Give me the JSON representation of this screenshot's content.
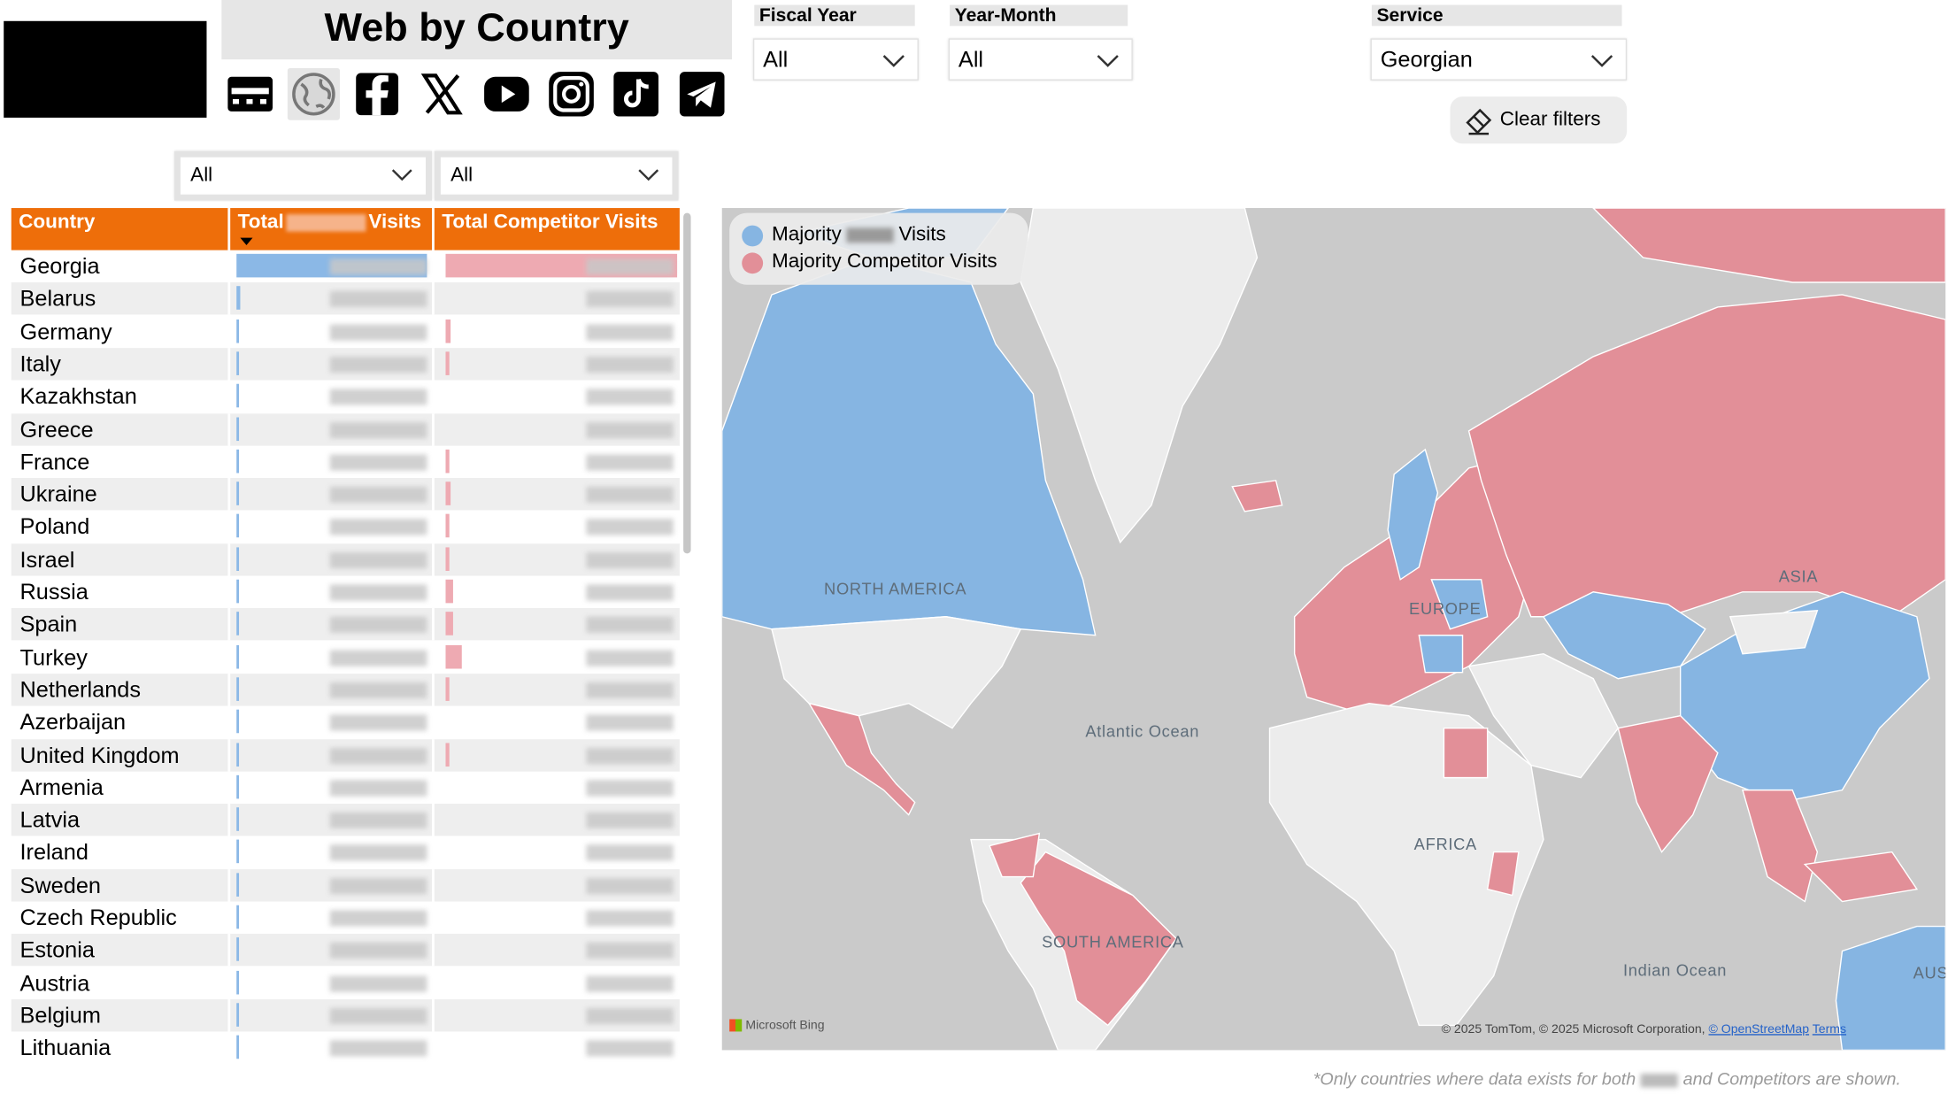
{
  "header": {
    "title": "Web by Country",
    "nav_icons": [
      "web-icon",
      "globe-icon",
      "facebook-icon",
      "x-icon",
      "youtube-icon",
      "instagram-icon",
      "tiktok-icon",
      "telegram-icon"
    ]
  },
  "filters": {
    "fiscal_year": {
      "label": "Fiscal Year",
      "value": "All"
    },
    "year_month": {
      "label": "Year-Month",
      "value": "All"
    },
    "service": {
      "label": "Service",
      "value": "Georgian"
    },
    "clear_label": "Clear filters",
    "column_filter_1": "All",
    "column_filter_2": "All"
  },
  "table": {
    "headers": {
      "country": "Country",
      "total_visits_prefix": "Total",
      "total_visits_suffix": "Visits",
      "competitor": "Total Competitor Visits"
    },
    "rows": [
      {
        "country": "Georgia",
        "visits_share": 1.0,
        "competitor_share": 1.0
      },
      {
        "country": "Belarus",
        "visits_share": 0.02,
        "competitor_share": 0.0
      },
      {
        "country": "Germany",
        "visits_share": 0.015,
        "competitor_share": 0.02
      },
      {
        "country": "Italy",
        "visits_share": 0.012,
        "competitor_share": 0.015
      },
      {
        "country": "Kazakhstan",
        "visits_share": 0.012,
        "competitor_share": 0.0
      },
      {
        "country": "Greece",
        "visits_share": 0.01,
        "competitor_share": 0.0
      },
      {
        "country": "France",
        "visits_share": 0.01,
        "competitor_share": 0.01
      },
      {
        "country": "Ukraine",
        "visits_share": 0.01,
        "competitor_share": 0.02
      },
      {
        "country": "Poland",
        "visits_share": 0.01,
        "competitor_share": 0.01
      },
      {
        "country": "Israel",
        "visits_share": 0.008,
        "competitor_share": 0.01
      },
      {
        "country": "Russia",
        "visits_share": 0.008,
        "competitor_share": 0.03
      },
      {
        "country": "Spain",
        "visits_share": 0.008,
        "competitor_share": 0.03
      },
      {
        "country": "Turkey",
        "visits_share": 0.008,
        "competitor_share": 0.07
      },
      {
        "country": "Netherlands",
        "visits_share": 0.006,
        "competitor_share": 0.01
      },
      {
        "country": "Azerbaijan",
        "visits_share": 0.006,
        "competitor_share": 0.0
      },
      {
        "country": "United Kingdom",
        "visits_share": 0.006,
        "competitor_share": 0.01
      },
      {
        "country": "Armenia",
        "visits_share": 0.004,
        "competitor_share": 0.0
      },
      {
        "country": "Latvia",
        "visits_share": 0.004,
        "competitor_share": 0.0
      },
      {
        "country": "Ireland",
        "visits_share": 0.004,
        "competitor_share": 0.0
      },
      {
        "country": "Sweden",
        "visits_share": 0.004,
        "competitor_share": 0.0
      },
      {
        "country": "Czech Republic",
        "visits_share": 0.004,
        "competitor_share": 0.0
      },
      {
        "country": "Estonia",
        "visits_share": 0.004,
        "competitor_share": 0.0
      },
      {
        "country": "Austria",
        "visits_share": 0.004,
        "competitor_share": 0.0
      },
      {
        "country": "Belgium",
        "visits_share": 0.004,
        "competitor_share": 0.0
      },
      {
        "country": "Lithuania",
        "visits_share": 0.004,
        "competitor_share": 0.0
      }
    ]
  },
  "map": {
    "legend": {
      "majority_prefix": "Majority",
      "majority_suffix": "Visits",
      "competitor": "Majority Competitor Visits"
    },
    "colors": {
      "majority": "#86b5e2",
      "competitor": "#e28f98",
      "land": "#ececec",
      "water": "#cacaca"
    },
    "labels": {
      "north_america": "NORTH AMERICA",
      "south_america": "SOUTH AMERICA",
      "europe": "EUROPE",
      "asia": "ASIA",
      "africa": "AFRICA",
      "atlantic": "Atlantic Ocean",
      "indian": "Indian Ocean",
      "aus": "AUS"
    },
    "attribution": "Microsoft Bing",
    "copyright_prefix": "© 2025 TomTom, © 2025 Microsoft Corporation,",
    "copyright_osm": "© OpenStreetMap",
    "copyright_terms": "Terms"
  },
  "footnote": {
    "prefix": "*Only countries where data exists for both",
    "suffix": "and Competitors are shown."
  }
}
